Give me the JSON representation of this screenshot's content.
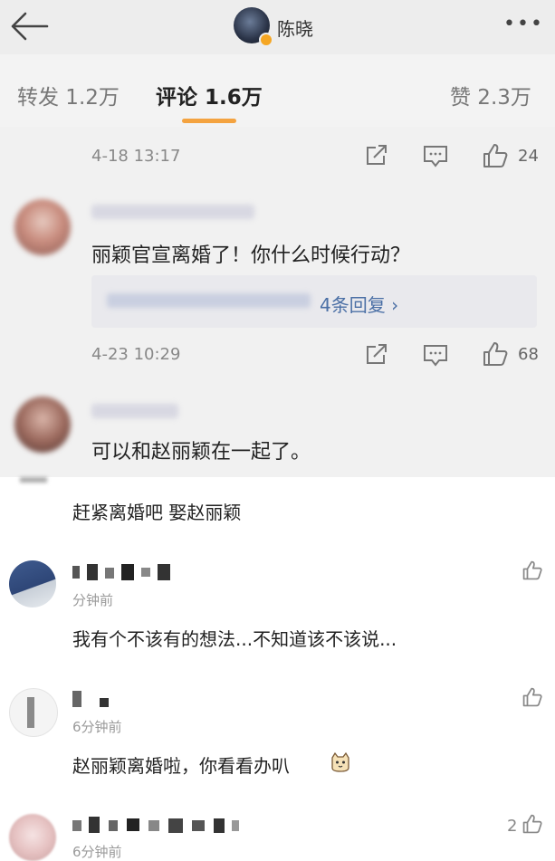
{
  "header": {
    "user_name": "陈晓",
    "more_label": "•••"
  },
  "tabs": [
    {
      "label": "转发 1.2万"
    },
    {
      "label": "评论 1.6万"
    },
    {
      "label": "赞 2.3万"
    }
  ],
  "weibo_comments": [
    {
      "time": "4-18 13:17",
      "likes": "24"
    },
    {
      "text": "丽颖官宣离婚了！你什么时候行动？",
      "replies_label": "4条回复 ›",
      "time": "4-23 10:29",
      "likes": "68"
    },
    {
      "text": "可以和赵丽颖在一起了。"
    }
  ],
  "lower_comments": [
    {
      "text": "赶紧离婚吧 娶赵丽颖"
    },
    {
      "time": "分钟前",
      "text": "我有个不该有的想法...不知道该不该说..."
    },
    {
      "time": "6分钟前",
      "text": "赵丽颖离婚啦，你看看办叭"
    },
    {
      "time": "6分钟前",
      "likes": "2"
    }
  ],
  "colors": {
    "accent": "#f4a340",
    "link": "#4a6fa5"
  }
}
